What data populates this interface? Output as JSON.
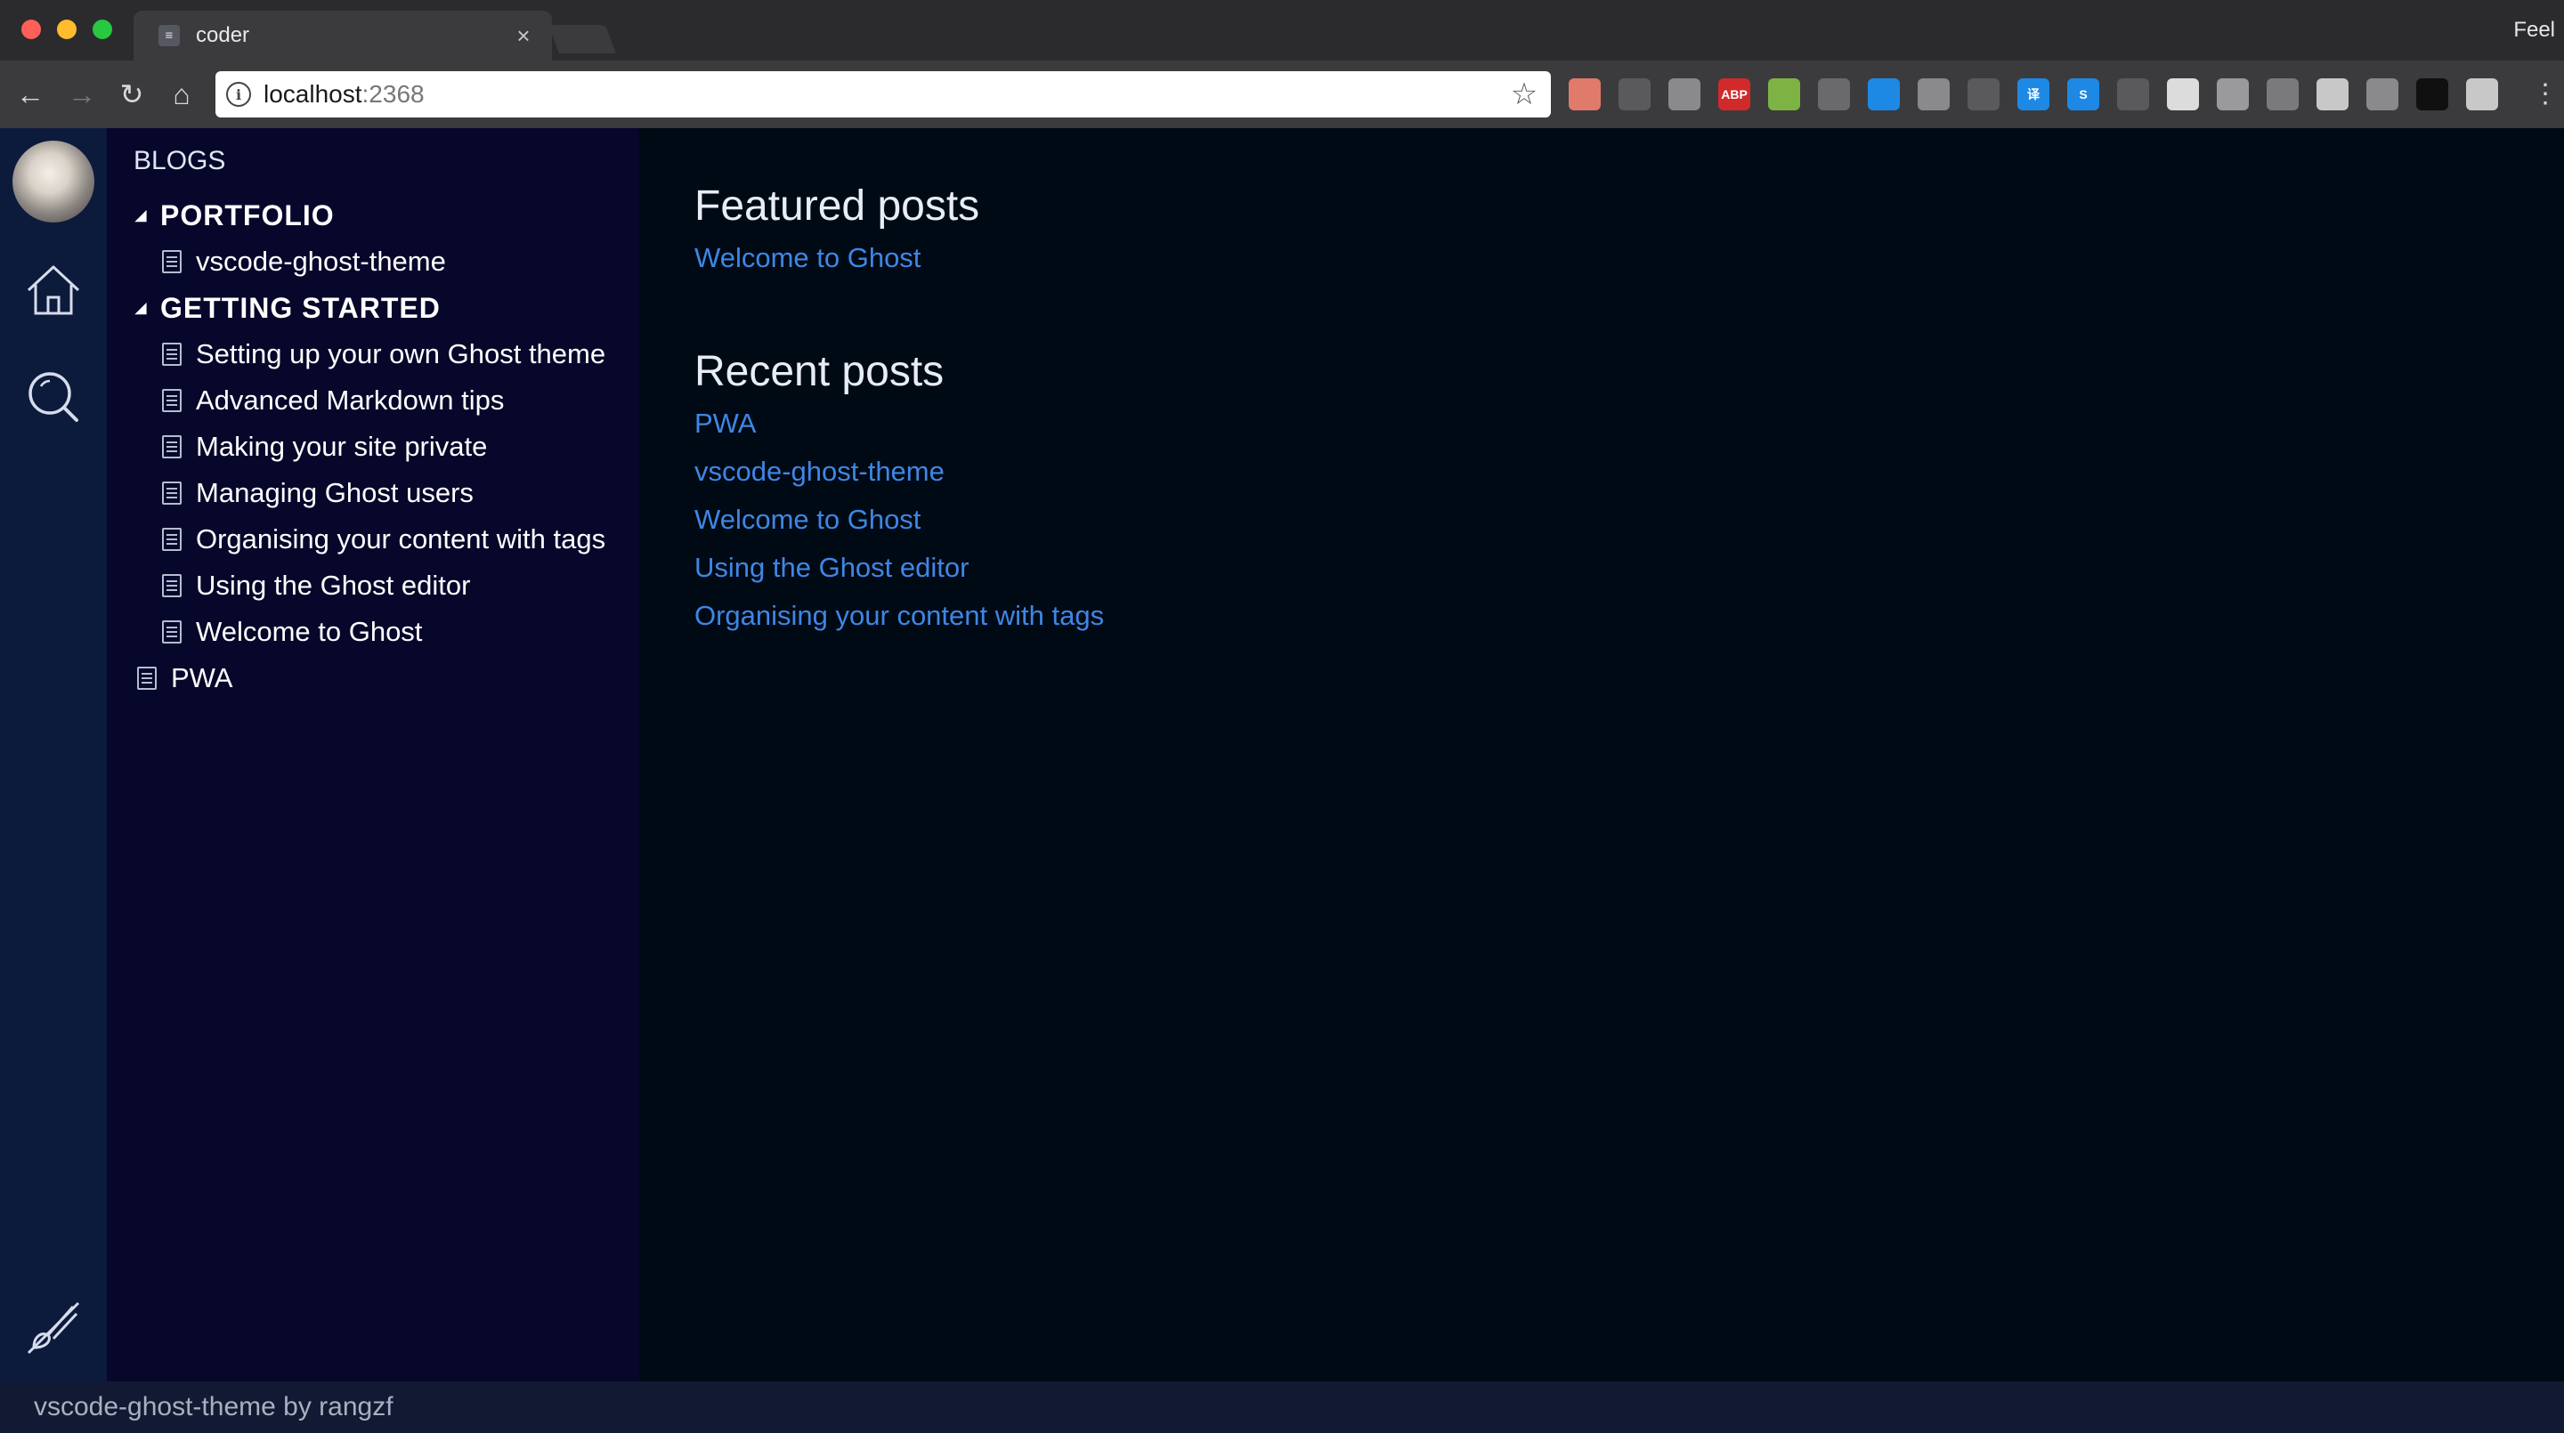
{
  "browser": {
    "tab_title": "coder",
    "tab_favicon": "≡",
    "tab_close": "×",
    "profile_name": "Feel",
    "url_host": "localhost",
    "url_port": ":2368",
    "nav": {
      "back": "←",
      "forward": "→",
      "reload": "↻",
      "home": "⌂"
    },
    "star": "☆",
    "menu": "⋮",
    "extensions": [
      {
        "name": "record-icon",
        "color": "#e07a6a",
        "label": ""
      },
      {
        "name": "bracket-icon",
        "color": "#5a5a5c",
        "label": ""
      },
      {
        "name": "pocket-icon",
        "color": "#8a8a8c",
        "label": ""
      },
      {
        "name": "adblock-plus-icon",
        "color": "#d12a2a",
        "label": "ABP"
      },
      {
        "name": "android-icon",
        "color": "#7cb342",
        "label": ""
      },
      {
        "name": "qr-code-icon",
        "color": "#6a6a6c",
        "label": ""
      },
      {
        "name": "download-icon",
        "color": "#1e88e5",
        "label": ""
      },
      {
        "name": "shield-icon",
        "color": "#8a8a8c",
        "label": ""
      },
      {
        "name": "react-icon",
        "color": "#5a5a5c",
        "label": ""
      },
      {
        "name": "translate-icon",
        "color": "#1e88e5",
        "label": "译"
      },
      {
        "name": "s-icon",
        "color": "#1e88e5",
        "label": "S"
      },
      {
        "name": "target-icon",
        "color": "#5a5a5c",
        "label": ""
      },
      {
        "name": "circle-icon",
        "color": "#dcdcdc",
        "label": ""
      },
      {
        "name": "image-icon",
        "color": "#9a9a9c",
        "label": ""
      },
      {
        "name": "vue-icon",
        "color": "#7a7a7c",
        "label": ""
      },
      {
        "name": "cube-icon",
        "color": "#c8c8c8",
        "label": ""
      },
      {
        "name": "puzzle-icon",
        "color": "#8a8a8c",
        "label": ""
      },
      {
        "name": "color-wheel-icon",
        "color": "#101010",
        "label": ""
      },
      {
        "name": "grid-icon",
        "color": "#c8c8c8",
        "label": ""
      }
    ]
  },
  "sidebar": {
    "heading": "BLOGS",
    "folders": [
      {
        "label": "PORTFOLIO",
        "files": [
          "vscode-ghost-theme"
        ]
      },
      {
        "label": "GETTING STARTED",
        "files": [
          "Setting up your own Ghost theme",
          "Advanced Markdown tips",
          "Making your site private",
          "Managing Ghost users",
          "Organising your content with tags",
          "Using the Ghost editor",
          "Welcome to Ghost"
        ]
      }
    ],
    "root_files": [
      "PWA"
    ]
  },
  "main": {
    "featured_title": "Featured posts",
    "featured_posts": [
      "Welcome to Ghost"
    ],
    "recent_title": "Recent posts",
    "recent_posts": [
      "PWA",
      "vscode-ghost-theme",
      "Welcome to Ghost",
      "Using the Ghost editor",
      "Organising your content with tags"
    ]
  },
  "status": {
    "text": "vscode-ghost-theme by rangzf"
  },
  "colors": {
    "activitybar": "#0c1a3c",
    "sidebar": "#07072b",
    "main": "#000a14",
    "link": "#3f86e6",
    "statusbar": "#121a33"
  }
}
